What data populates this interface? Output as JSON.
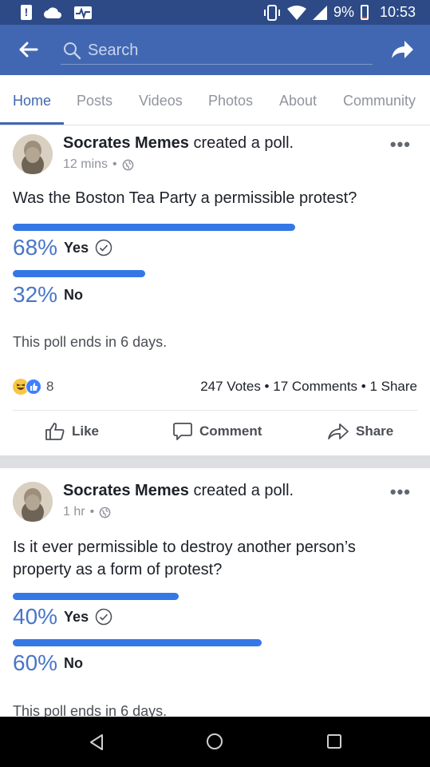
{
  "status_bar": {
    "battery": "9%",
    "time": "10:53"
  },
  "header": {
    "search_placeholder": "Search"
  },
  "tabs": [
    {
      "label": "Home",
      "active": true
    },
    {
      "label": "Posts"
    },
    {
      "label": "Videos"
    },
    {
      "label": "Photos"
    },
    {
      "label": "About"
    },
    {
      "label": "Community"
    }
  ],
  "posts": [
    {
      "author": "Socrates Memes",
      "action": "created a poll.",
      "time": "12 mins",
      "question": "Was the Boston Tea Party a permissible protest?",
      "options": [
        {
          "percent": "68%",
          "label": "Yes",
          "voted": true,
          "fraction": 0.68
        },
        {
          "percent": "32%",
          "label": "No",
          "voted": false,
          "fraction": 0.32
        }
      ],
      "ends": "This poll ends in 6 days.",
      "reaction_count": "8",
      "stats": "247 Votes • 17 Comments • 1 Share",
      "actions": {
        "like": "Like",
        "comment": "Comment",
        "share": "Share"
      }
    },
    {
      "author": "Socrates Memes",
      "action": "created a poll.",
      "time": "1 hr",
      "question": "Is it ever permissible to destroy another person’s property as a form of protest?",
      "options": [
        {
          "percent": "40%",
          "label": "Yes",
          "voted": true,
          "fraction": 0.4
        },
        {
          "percent": "60%",
          "label": "No",
          "voted": false,
          "fraction": 0.6
        }
      ],
      "ends": "This poll ends in 6 days."
    }
  ],
  "colors": {
    "status_bar": "#2d4a86",
    "app_bar": "#4267b2",
    "poll_bar": "#3578e5",
    "percent_text": "#4a76c8"
  }
}
